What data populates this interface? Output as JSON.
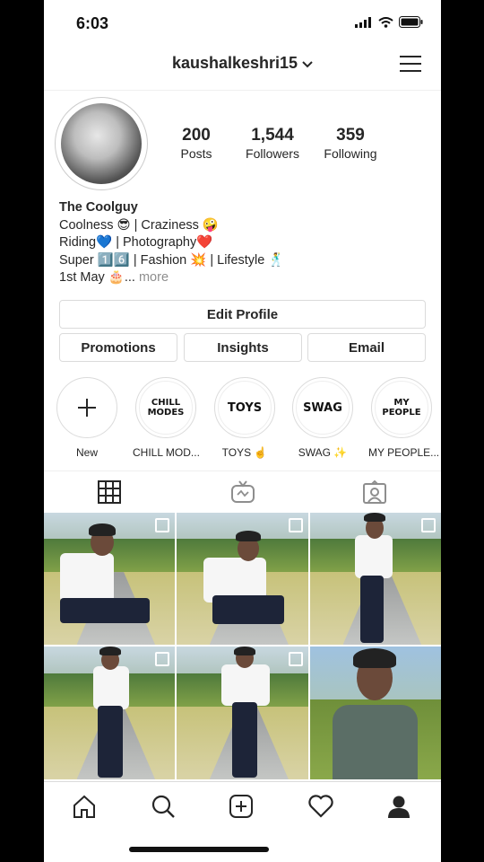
{
  "status_bar": {
    "time": "6:03"
  },
  "header": {
    "username": "kaushalkeshri15"
  },
  "stats": {
    "posts": {
      "value": "200",
      "label": "Posts"
    },
    "followers": {
      "value": "1,544",
      "label": "Followers"
    },
    "following": {
      "value": "359",
      "label": "Following"
    }
  },
  "bio": {
    "name": "The Coolguy",
    "line1": "Coolness 😎 | Craziness 🤪",
    "line2": "Riding💙 | Photography❤️",
    "line3": "Super 1️⃣6️⃣ | Fashion 💥 | Lifestyle 🕺",
    "line4": "1st May 🎂...",
    "more": "more"
  },
  "buttons": {
    "edit_profile": "Edit Profile",
    "promotions": "Promotions",
    "insights": "Insights",
    "email": "Email"
  },
  "highlights": [
    {
      "cover": "",
      "label": "New",
      "icon": "plus-icon"
    },
    {
      "cover": "CHILL MODES",
      "label": "CHILL MOD..."
    },
    {
      "cover": "TOYS",
      "label": "TOYS ☝️"
    },
    {
      "cover": "SWAG",
      "label": "SWAG ✨"
    },
    {
      "cover": "MY PEOPLE",
      "label": "MY PEOPLE..."
    }
  ],
  "tabs": [
    "grid-icon",
    "igtv-icon",
    "tagged-icon"
  ],
  "bottom_nav": [
    "home-icon",
    "search-icon",
    "add-post-icon",
    "activity-heart-icon",
    "profile-icon"
  ],
  "colors": {
    "text": "#262626",
    "secondary": "#8e8e8e",
    "border": "#dbdbdb"
  }
}
